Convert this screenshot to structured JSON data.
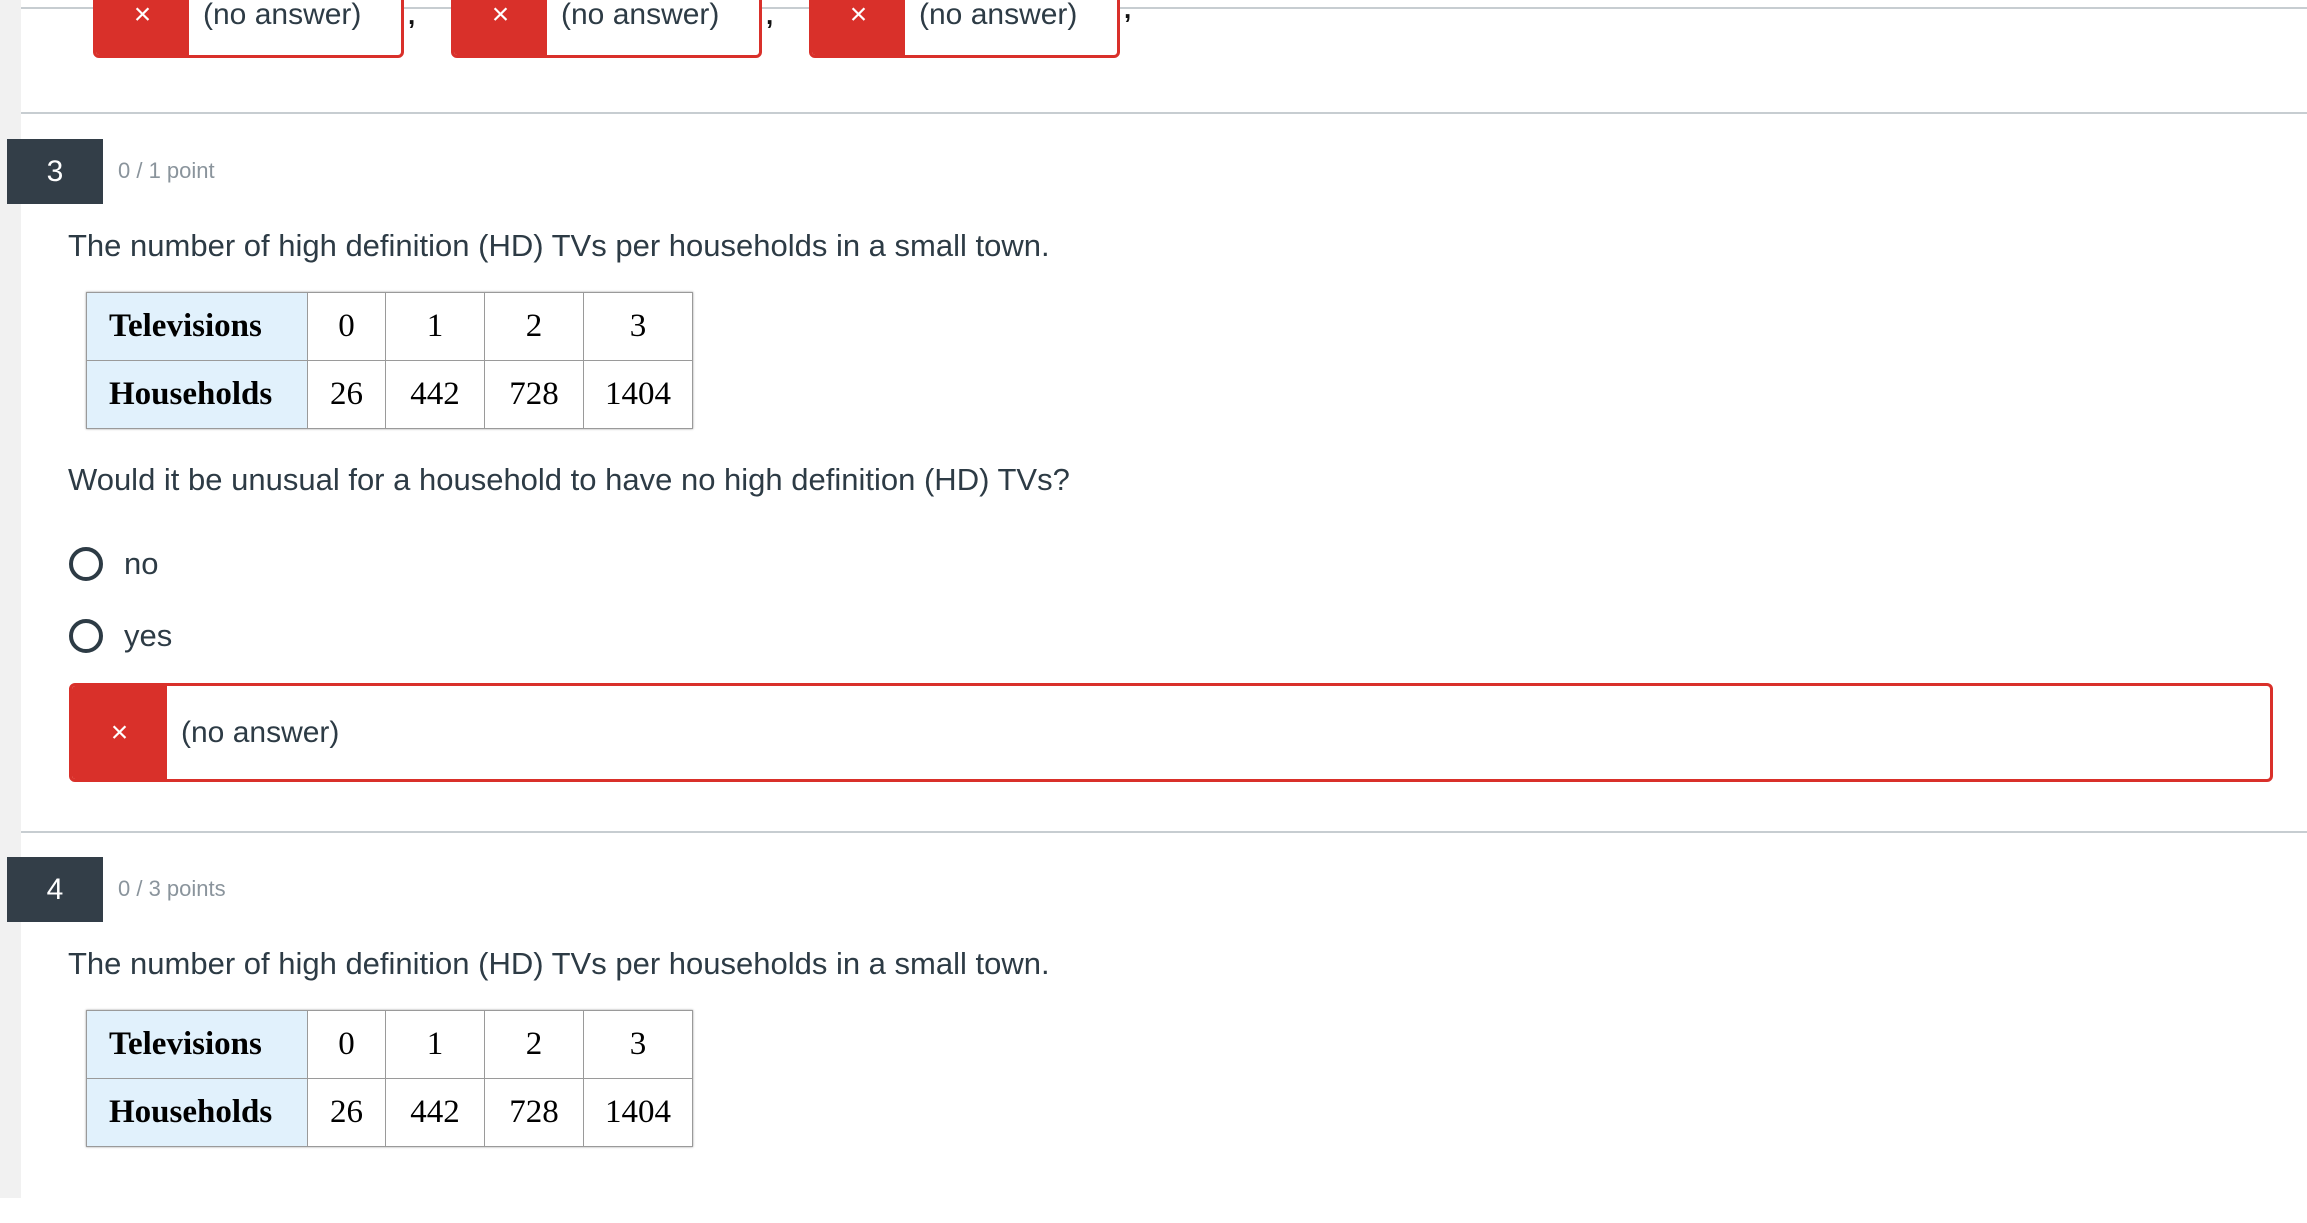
{
  "previous_answers": {
    "items": [
      {
        "icon": "×",
        "text": "(no answer)",
        "separator": ","
      },
      {
        "icon": "×",
        "text": "(no answer)",
        "separator": ","
      },
      {
        "icon": "×",
        "text": "(no answer)",
        "separator": ","
      }
    ]
  },
  "questions": [
    {
      "number": "3",
      "points": "0 / 1 point",
      "intro": "The number of high definition (HD) TVs per households in a small town.",
      "table": {
        "rows": [
          {
            "header": "Televisions",
            "values": [
              "0",
              "1",
              "2",
              "3"
            ]
          },
          {
            "header": "Households",
            "values": [
              "26",
              "442",
              "728",
              "1404"
            ]
          }
        ]
      },
      "prompt": "Would it be unusual for a household to have no high definition (HD) TVs?",
      "options": [
        "no",
        "yes"
      ],
      "answer": {
        "icon": "×",
        "text": "(no answer)"
      }
    },
    {
      "number": "4",
      "points": "0 / 3 points",
      "intro": "The number of high definition (HD) TVs per households in a small town.",
      "table": {
        "rows": [
          {
            "header": "Televisions",
            "values": [
              "0",
              "1",
              "2",
              "3"
            ]
          },
          {
            "header": "Households",
            "values": [
              "26",
              "442",
              "728",
              "1404"
            ]
          }
        ]
      }
    }
  ],
  "colors": {
    "incorrect": "#d9302a",
    "badge": "#333e48",
    "text": "#2d3b45",
    "table_header_bg": "#e1f1fc"
  }
}
